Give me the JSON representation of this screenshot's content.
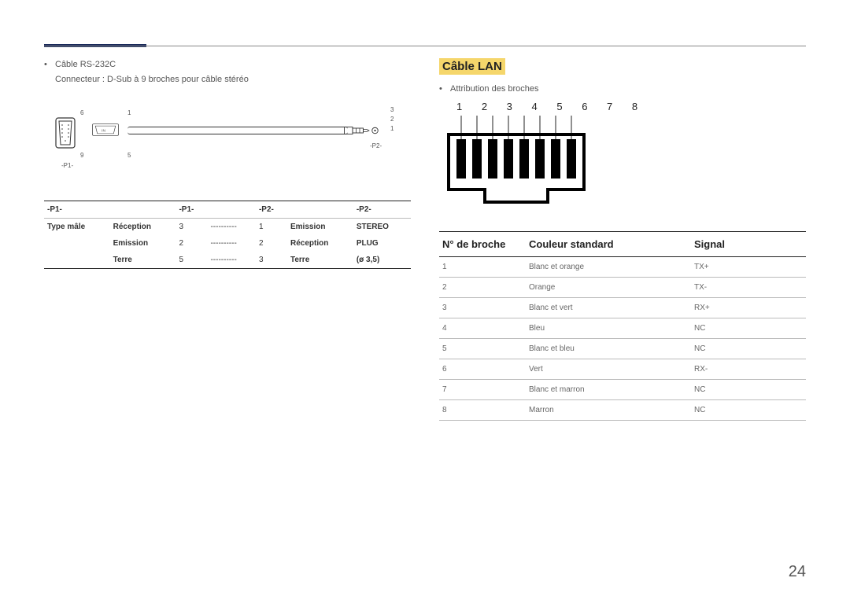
{
  "left": {
    "bullet1": "Câble RS-232C",
    "bullet1_sub": "Connecteur : D-Sub à 9 broches pour câble stéréo",
    "diagram": {
      "p1_label": "-P1-",
      "p2_label": "-P2-",
      "dsub_nums": {
        "tl": "6",
        "tr": "1",
        "bl": "9",
        "br": "5"
      },
      "plug_nums": [
        "3",
        "2",
        "1"
      ]
    },
    "table": {
      "headers": [
        "-P1-",
        "",
        "-P1-",
        "",
        "-P2-",
        "",
        "-P2-"
      ],
      "rows": [
        [
          "Type mâle",
          "Réception",
          "3",
          "----------",
          "1",
          "Emission",
          "STEREO"
        ],
        [
          "",
          "Emission",
          "2",
          "----------",
          "2",
          "Réception",
          "PLUG"
        ],
        [
          "",
          "Terre",
          "5",
          "----------",
          "3",
          "Terre",
          "(ø 3,5)"
        ]
      ]
    }
  },
  "right": {
    "heading": "Câble LAN",
    "bullet1": "Attribution des broches",
    "rj45_nums": "1 2 3 4 5 6 7 8",
    "lan_table": {
      "headers": {
        "pin": "N° de broche",
        "color": "Couleur standard",
        "signal": "Signal"
      },
      "rows": [
        {
          "pin": "1",
          "color": "Blanc et orange",
          "signal": "TX+"
        },
        {
          "pin": "2",
          "color": "Orange",
          "signal": "TX-"
        },
        {
          "pin": "3",
          "color": "Blanc et vert",
          "signal": "RX+"
        },
        {
          "pin": "4",
          "color": "Bleu",
          "signal": "NC"
        },
        {
          "pin": "5",
          "color": "Blanc et bleu",
          "signal": "NC"
        },
        {
          "pin": "6",
          "color": "Vert",
          "signal": "RX-"
        },
        {
          "pin": "7",
          "color": "Blanc et marron",
          "signal": "NC"
        },
        {
          "pin": "8",
          "color": "Marron",
          "signal": "NC"
        }
      ]
    }
  },
  "page_number": "24"
}
